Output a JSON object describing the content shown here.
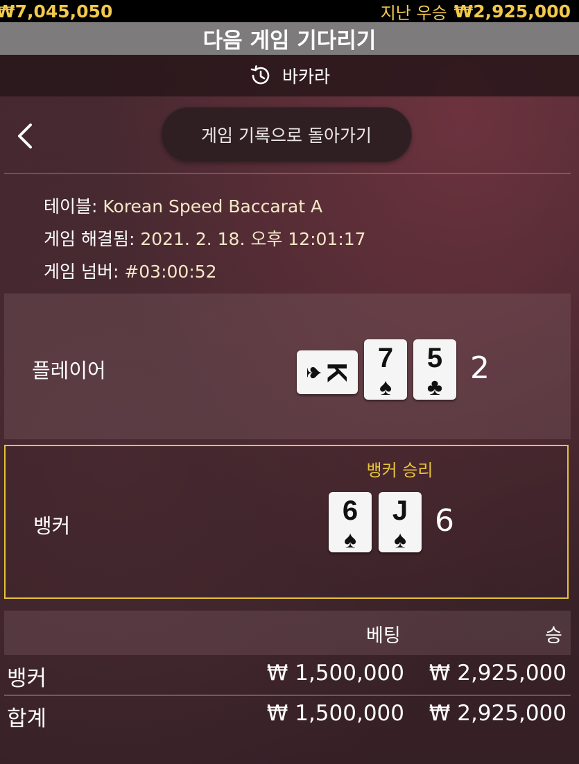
{
  "top_bar": {
    "balance": "₩7,045,050",
    "last_win_label": "지난 우승",
    "last_win_amount": "₩2,925,000"
  },
  "status": "다음 게임 기다리기",
  "game_header": {
    "icon": "history-icon",
    "title": "바카라"
  },
  "back_button_label": "게임 기록으로 돌아가기",
  "info": {
    "table_label": "테이블: ",
    "table_value": "Korean Speed Baccarat A",
    "resolved_label": "게임 해결됨: ",
    "resolved_value": "2021. 2. 18. 오후 12:01:17",
    "number_label": "게임 넘버: ",
    "number_value": "#03:00:52"
  },
  "player": {
    "label": "플레이어",
    "cards": [
      {
        "rank": "K",
        "suit": "♠"
      },
      {
        "rank": "7",
        "suit": "♠"
      },
      {
        "rank": "5",
        "suit": "♣"
      }
    ],
    "score": "2"
  },
  "banker": {
    "label": "뱅커",
    "result": "뱅커 승리",
    "cards": [
      {
        "rank": "6",
        "suit": "♠"
      },
      {
        "rank": "J",
        "suit": "♠"
      }
    ],
    "score": "6"
  },
  "bets": {
    "header_bet": "베팅",
    "header_win": "승",
    "rows": [
      {
        "name": "뱅커",
        "bet": "₩ 1,500,000",
        "win": "₩ 2,925,000"
      },
      {
        "name": "합계",
        "bet": "₩ 1,500,000",
        "win": "₩ 2,925,000"
      }
    ]
  },
  "colors": {
    "accent_gold": "#f2c94c",
    "winner_border": "#e6c33a"
  }
}
